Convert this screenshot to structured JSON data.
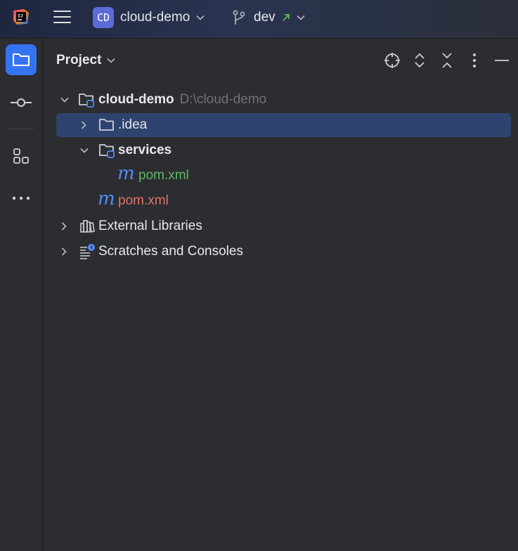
{
  "titlebar": {
    "app_logo_icon": "intellij-idea-logo-icon",
    "menu_icon": "hamburger-menu-icon",
    "project_badge": "CD",
    "project_badge_color": "#5d6bd6",
    "project_name": "cloud-demo",
    "branch_icon": "git-branch-icon",
    "branch_name": "dev",
    "branch_status_icon": "push-arrow-icon",
    "branch_status_color": "#5fb865"
  },
  "toolstrip": {
    "items": [
      {
        "name": "project-tool",
        "icon": "folder-icon",
        "active": true
      },
      {
        "name": "commit-tool",
        "icon": "commit-icon",
        "active": false
      },
      {
        "name": "structure-tool",
        "icon": "structure-icon",
        "active": false
      },
      {
        "name": "more-tools",
        "icon": "more-horizontal-icon",
        "active": false
      }
    ],
    "accent": "#3574f0"
  },
  "panel": {
    "title": "Project",
    "header_actions": [
      {
        "name": "locate-button",
        "icon": "crosshair-icon"
      },
      {
        "name": "expand-all-button",
        "icon": "expand-all-icon"
      },
      {
        "name": "collapse-all-button",
        "icon": "collapse-all-icon"
      },
      {
        "name": "options-button",
        "icon": "vertical-dots-icon"
      },
      {
        "name": "hide-button",
        "icon": "minus-icon"
      }
    ]
  },
  "tree": {
    "rows": [
      {
        "label": "cloud-demo",
        "path": "D:\\cloud-demo",
        "icon": "module-folder-icon",
        "expanded": true
      },
      {
        "label": ".idea",
        "icon": "folder-icon",
        "expanded": false,
        "selected": true
      },
      {
        "label": "services",
        "icon": "module-folder-icon",
        "expanded": true
      },
      {
        "label": "pom.xml",
        "icon": "maven-icon",
        "status": "added",
        "status_color": "#5fb865"
      },
      {
        "label": "pom.xml",
        "icon": "maven-icon",
        "status": "unversioned",
        "status_color": "#e1736c"
      },
      {
        "label": "External Libraries",
        "icon": "libraries-icon",
        "expanded": false
      },
      {
        "label": "Scratches and Consoles",
        "icon": "scratches-icon",
        "expanded": false
      }
    ],
    "selection_color": "#2e436e"
  }
}
